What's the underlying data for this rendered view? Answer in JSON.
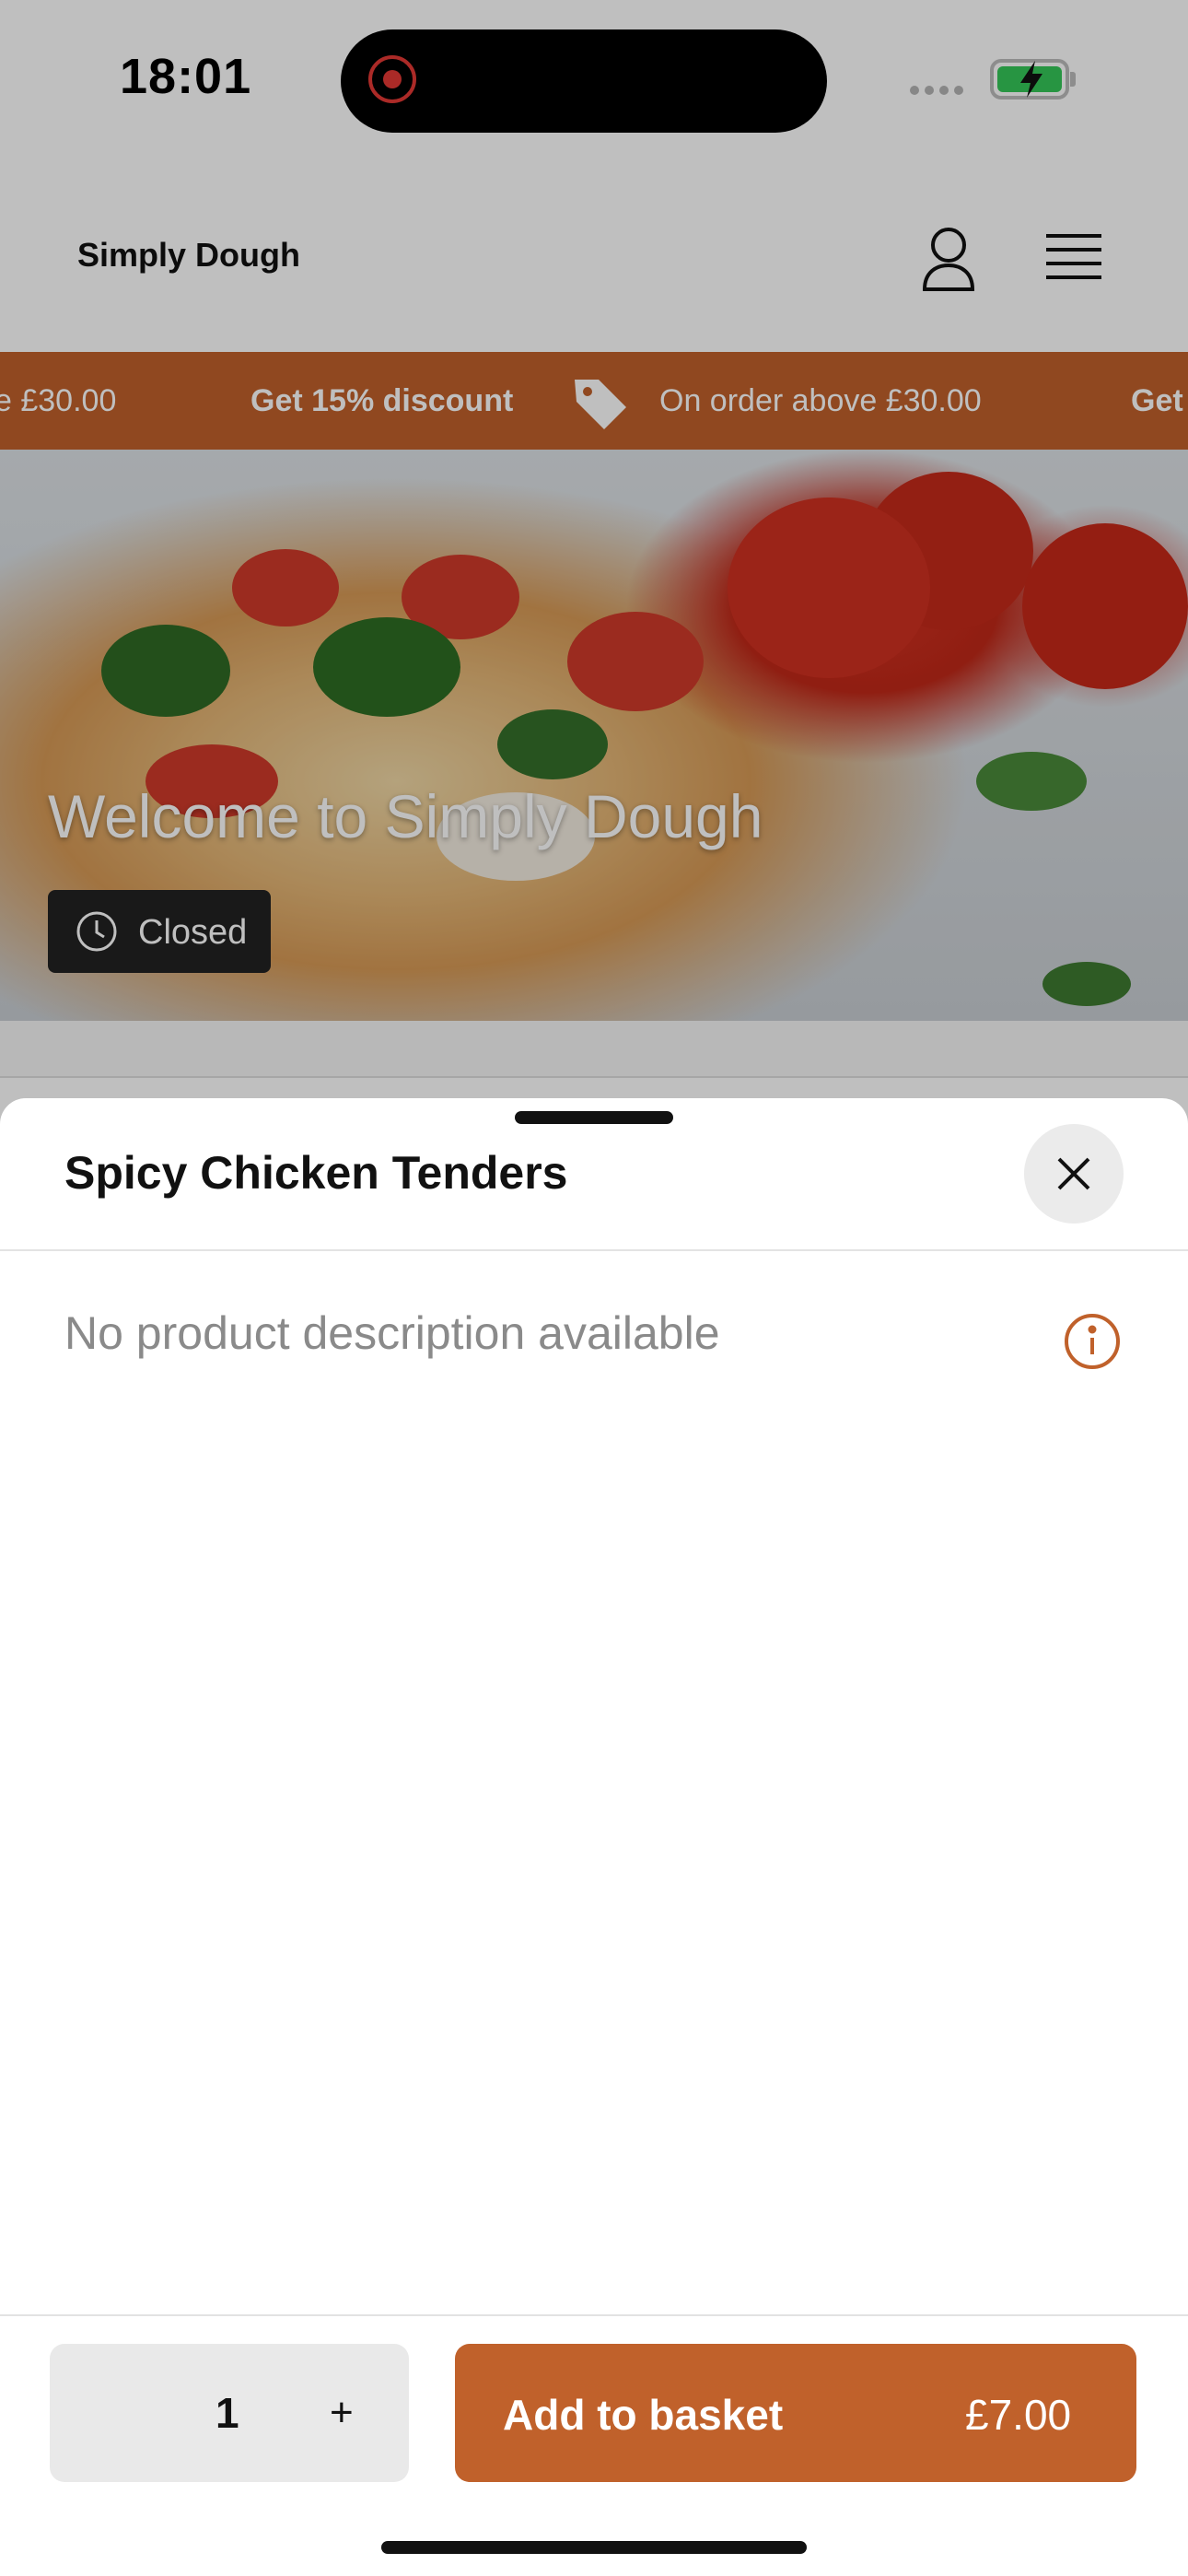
{
  "status_bar": {
    "time": "18:01"
  },
  "header": {
    "brand": "Simply Dough"
  },
  "promo": {
    "left_fragment": "e £30.00",
    "discount": "Get 15% discount",
    "condition": "On order above £30.00",
    "right_fragment": "Get"
  },
  "hero": {
    "title": "Welcome to Simply Dough",
    "status": "Closed"
  },
  "sheet": {
    "title": "Spicy Chicken Tenders",
    "description": "No product description available"
  },
  "footer": {
    "quantity": "1",
    "plus_label": "+",
    "add_label": "Add to basket",
    "price": "£7.00"
  },
  "colors": {
    "accent": "#c0612b",
    "closed_pill": "#222222",
    "close_button_bg": "#ebebeb"
  },
  "icons": [
    "user-icon",
    "menu-icon",
    "tag-icon",
    "clock-icon",
    "close-icon",
    "info-icon",
    "battery-icon"
  ]
}
